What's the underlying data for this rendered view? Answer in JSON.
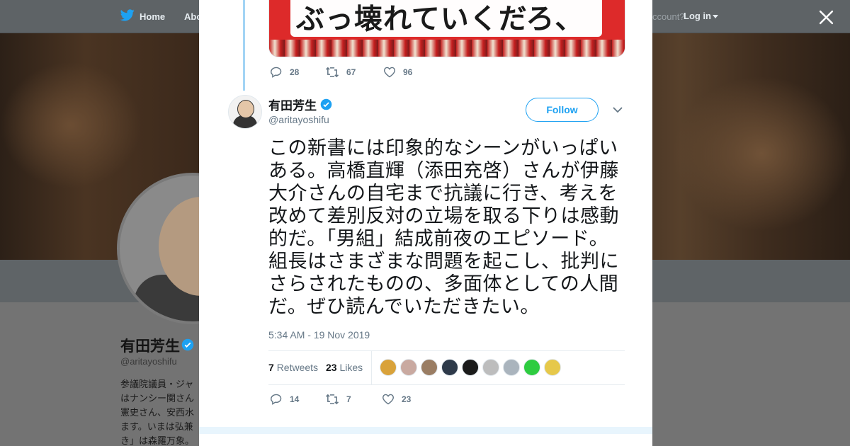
{
  "nav": {
    "home_label": "Home",
    "about_label": "Abo",
    "account_text": "ccount?",
    "login_label": "Log in"
  },
  "profile": {
    "name": "有田芳生",
    "handle": "@aritayoshifu",
    "bio": "参議院議員・ジャ\nはナンシー関さん\n憲史さん、安西水\nます。いまは弘兼\nき」は森羅万象。"
  },
  "quoted": {
    "image_text": "ぶっ壊れていくだろ、",
    "replies": "28",
    "retweets": "67",
    "likes": "96"
  },
  "tweet": {
    "name": "有田芳生",
    "handle": "@aritayoshifu",
    "follow_label": "Follow",
    "text": "この新書には印象的なシーンがいっぱいある。高橋直輝（添田充啓）さんが伊藤大介さんの自宅まで抗議に行き、考えを改めて差別反対の立場を取る下りは感動的だ。「男組」結成前夜のエピソード。組長はさまざまな問題を起こし、批判にさらされたものの、多面体としての人間だ。ぜひ読んでいただきたい。",
    "timestamp": "5:34 AM - 19 Nov 2019",
    "retweets_count": "7",
    "retweets_label": "Retweets",
    "likes_count": "23",
    "likes_label": "Likes",
    "replies": "14",
    "retweets": "7",
    "likes": "23"
  },
  "likers": [
    {
      "color": "#d9a23a"
    },
    {
      "color": "#c9a9a0"
    },
    {
      "color": "#9a7d63"
    },
    {
      "color": "#2e3a4a"
    },
    {
      "color": "#1b1b1b"
    },
    {
      "color": "#bdbdbd"
    },
    {
      "color": "#aab4bd"
    },
    {
      "color": "#2ecc40"
    },
    {
      "color": "#e6c84a"
    }
  ],
  "colors": {
    "accent": "#1da1f2",
    "text_secondary": "#657786"
  }
}
